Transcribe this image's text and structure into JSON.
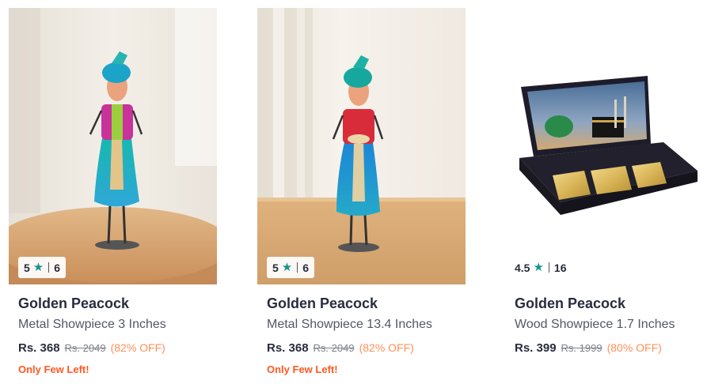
{
  "products": [
    {
      "image_alt": "Metal musician figurine on round wooden table",
      "rating": "5",
      "rating_count": "6",
      "brand": "Golden Peacock",
      "name": "Metal Showpiece 3 Inches",
      "price": "Rs. 368",
      "mrp": "Rs. 2049",
      "discount": "(82% OFF)",
      "stock_note": "Only Few Left!"
    },
    {
      "image_alt": "Metal musician figurine with red top on wooden table",
      "rating": "5",
      "rating_count": "6",
      "brand": "Golden Peacock",
      "name": "Metal Showpiece 13.4 Inches",
      "price": "Rs. 368",
      "mrp": "Rs. 2049",
      "discount": "(82% OFF)",
      "stock_note": "Only Few Left!"
    },
    {
      "image_alt": "Wooden box with gold plaques and mosque picture",
      "rating": "4.5",
      "rating_count": "16",
      "brand": "Golden Peacock",
      "name": "Wood Showpiece 1.7 Inches",
      "price": "Rs. 399",
      "mrp": "Rs. 1999",
      "discount": "(80% OFF)",
      "stock_note": ""
    }
  ],
  "colors": {
    "star": "#14958f",
    "discount": "#ff905a",
    "stock": "#ff5722",
    "text_dark": "#282c3f",
    "text_muted": "#535766"
  },
  "icons": {
    "rating": "star-icon"
  }
}
